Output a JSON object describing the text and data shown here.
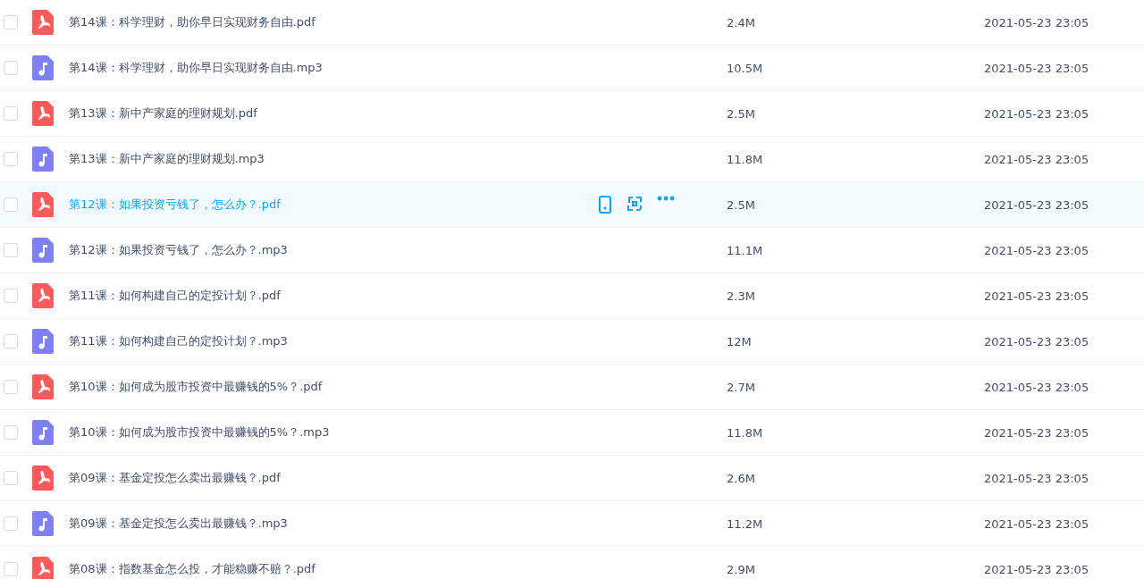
{
  "files": [
    {
      "kind": "pdf",
      "name": "第14课：科学理财，助你早日实现财务自由.pdf",
      "size": "2.4M",
      "modified": "2021-05-23 23:05",
      "checked": false,
      "hovered": false
    },
    {
      "kind": "audio",
      "name": "第14课：科学理财，助你早日实现财务自由.mp3",
      "size": "10.5M",
      "modified": "2021-05-23 23:05",
      "checked": false,
      "hovered": false
    },
    {
      "kind": "pdf",
      "name": "第13课：新中产家庭的理财规划.pdf",
      "size": "2.5M",
      "modified": "2021-05-23 23:05",
      "checked": false,
      "hovered": false
    },
    {
      "kind": "audio",
      "name": "第13课：新中产家庭的理财规划.mp3",
      "size": "11.8M",
      "modified": "2021-05-23 23:05",
      "checked": false,
      "hovered": false
    },
    {
      "kind": "pdf",
      "name": "第12课：如果投资亏钱了，怎么办？.pdf",
      "size": "2.5M",
      "modified": "2021-05-23 23:05",
      "checked": false,
      "hovered": true
    },
    {
      "kind": "audio",
      "name": "第12课：如果投资亏钱了，怎么办？.mp3",
      "size": "11.1M",
      "modified": "2021-05-23 23:05",
      "checked": false,
      "hovered": false
    },
    {
      "kind": "pdf",
      "name": "第11课：如何构建自己的定投计划？.pdf",
      "size": "2.3M",
      "modified": "2021-05-23 23:05",
      "checked": false,
      "hovered": false
    },
    {
      "kind": "audio",
      "name": "第11课：如何构建自己的定投计划？.mp3",
      "size": "12M",
      "modified": "2021-05-23 23:05",
      "checked": false,
      "hovered": false
    },
    {
      "kind": "pdf",
      "name": "第10课：如何成为股市投资中最赚钱的5%？.pdf",
      "size": "2.7M",
      "modified": "2021-05-23 23:05",
      "checked": false,
      "hovered": false
    },
    {
      "kind": "audio",
      "name": "第10课：如何成为股市投资中最赚钱的5%？.mp3",
      "size": "11.8M",
      "modified": "2021-05-23 23:05",
      "checked": false,
      "hovered": false
    },
    {
      "kind": "pdf",
      "name": "第09课：基金定投怎么卖出最赚钱？.pdf",
      "size": "2.6M",
      "modified": "2021-05-23 23:05",
      "checked": false,
      "hovered": false
    },
    {
      "kind": "audio",
      "name": "第09课：基金定投怎么卖出最赚钱？.mp3",
      "size": "11.2M",
      "modified": "2021-05-23 23:05",
      "checked": false,
      "hovered": false
    },
    {
      "kind": "pdf",
      "name": "第08课：指数基金怎么投，才能稳赚不赔？.pdf",
      "size": "2.9M",
      "modified": "2021-05-23 23:05",
      "checked": false,
      "hovered": false
    }
  ]
}
